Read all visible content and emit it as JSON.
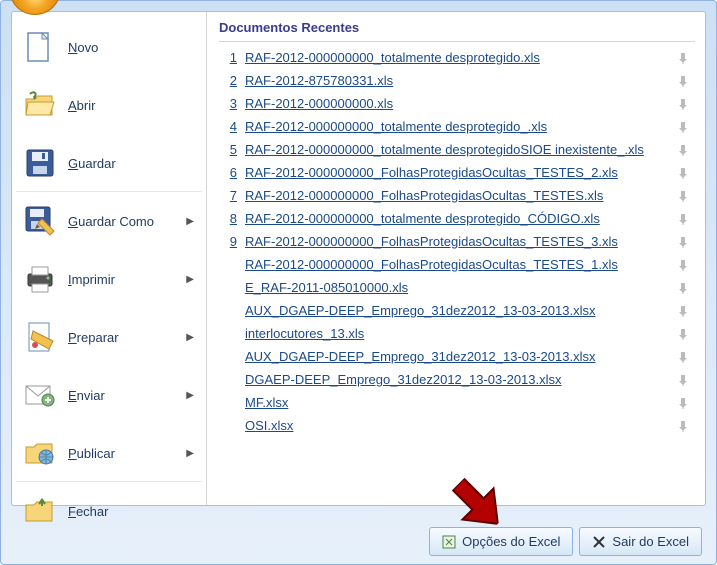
{
  "left_menu": [
    {
      "label": "Novo",
      "icon": "new-doc-icon",
      "submenu": false
    },
    {
      "label": "Abrir",
      "icon": "open-folder-icon",
      "submenu": false
    },
    {
      "label": "Guardar",
      "icon": "save-icon",
      "submenu": false
    },
    {
      "label": "Guardar Como",
      "icon": "save-as-icon",
      "submenu": true
    },
    {
      "label": "Imprimir",
      "icon": "print-icon",
      "submenu": true
    },
    {
      "label": "Preparar",
      "icon": "prepare-icon",
      "submenu": true
    },
    {
      "label": "Enviar",
      "icon": "send-icon",
      "submenu": true
    },
    {
      "label": "Publicar",
      "icon": "publish-icon",
      "submenu": true
    },
    {
      "label": "Fechar",
      "icon": "close-folder-icon",
      "submenu": false
    }
  ],
  "recent_title": "Documentos Recentes",
  "recent_items": [
    {
      "idx": "1",
      "label": "RAF-2012-000000000_totalmente desprotegido.xls"
    },
    {
      "idx": "2",
      "label": "RAF-2012-875780331.xls"
    },
    {
      "idx": "3",
      "label": "RAF-2012-000000000.xls"
    },
    {
      "idx": "4",
      "label": "RAF-2012-000000000_totalmente desprotegido_.xls"
    },
    {
      "idx": "5",
      "label": "RAF-2012-000000000_totalmente desprotegidoSIOE inexistente_.xls"
    },
    {
      "idx": "6",
      "label": "RAF-2012-000000000_FolhasProtegidasOcultas_TESTES_2.xls"
    },
    {
      "idx": "7",
      "label": "RAF-2012-000000000_FolhasProtegidasOcultas_TESTES.xls"
    },
    {
      "idx": "8",
      "label": "RAF-2012-000000000_totalmente desprotegido_CÓDIGO.xls"
    },
    {
      "idx": "9",
      "label": "RAF-2012-000000000_FolhasProtegidasOcultas_TESTES_3.xls"
    },
    {
      "idx": "",
      "label": "RAF-2012-000000000_FolhasProtegidasOcultas_TESTES_1.xls"
    },
    {
      "idx": "",
      "label": "E_RAF-2011-085010000.xls"
    },
    {
      "idx": "",
      "label": "AUX_DGAEP-DEEP_Emprego_31dez2012_13-03-2013.xlsx"
    },
    {
      "idx": "",
      "label": "interlocutores_13.xls"
    },
    {
      "idx": "",
      "label": "AUX_DGAEP-DEEP_Emprego_31dez2012_13-03-2013.xlsx"
    },
    {
      "idx": "",
      "label": "DGAEP-DEEP_Emprego_31dez2012_13-03-2013.xlsx"
    },
    {
      "idx": "",
      "label": "MF.xlsx"
    },
    {
      "idx": "",
      "label": "OSI.xlsx"
    }
  ],
  "bottom": {
    "options_label": "Opções do Excel",
    "exit_label": "Sair do Excel"
  }
}
